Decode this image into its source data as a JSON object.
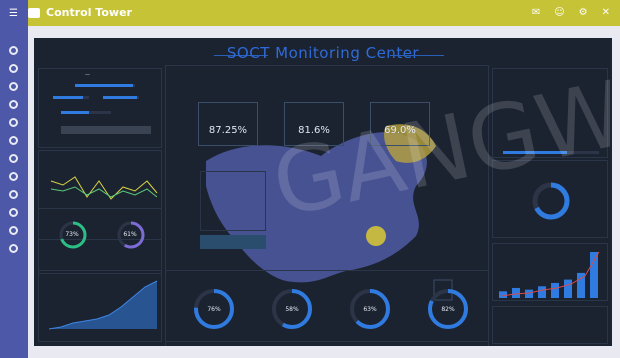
{
  "app": {
    "title": "Control Tower",
    "subtitle": "",
    "icons": [
      "mail-icon",
      "user-icon",
      "settings-icon",
      "close-icon"
    ]
  },
  "sidebar": {
    "items": [
      "home",
      "alert",
      "chart",
      "map",
      "list",
      "report",
      "settings",
      "help",
      "user",
      "logout",
      "file",
      "info"
    ]
  },
  "dashboard": {
    "title": "SOCT Monitoring Center",
    "kpis": [
      {
        "label": "",
        "value": "87.25%"
      },
      {
        "label": "",
        "value": "81.6%"
      },
      {
        "label": "",
        "value": "69.0%"
      }
    ],
    "left_top": {
      "rows": [
        {
          "label": "",
          "value": ""
        },
        {
          "label": "",
          "value": ""
        },
        {
          "label": "",
          "value": ""
        }
      ]
    },
    "gauges_left": [
      {
        "label": "",
        "value": "73%"
      },
      {
        "label": "",
        "value": "61%"
      }
    ],
    "bottom_gauges": [
      {
        "label": "",
        "value": "76%"
      },
      {
        "label": "",
        "value": "58%"
      },
      {
        "label": "",
        "value": "63%"
      },
      {
        "label": "",
        "value": "82%"
      }
    ],
    "mid_panel": {
      "label": "",
      "values": [
        "",
        ""
      ]
    },
    "button_label": "",
    "right_ring": {
      "value": 68
    },
    "right_bars": [
      8,
      12,
      10,
      14,
      18,
      22,
      30,
      55
    ]
  }
}
